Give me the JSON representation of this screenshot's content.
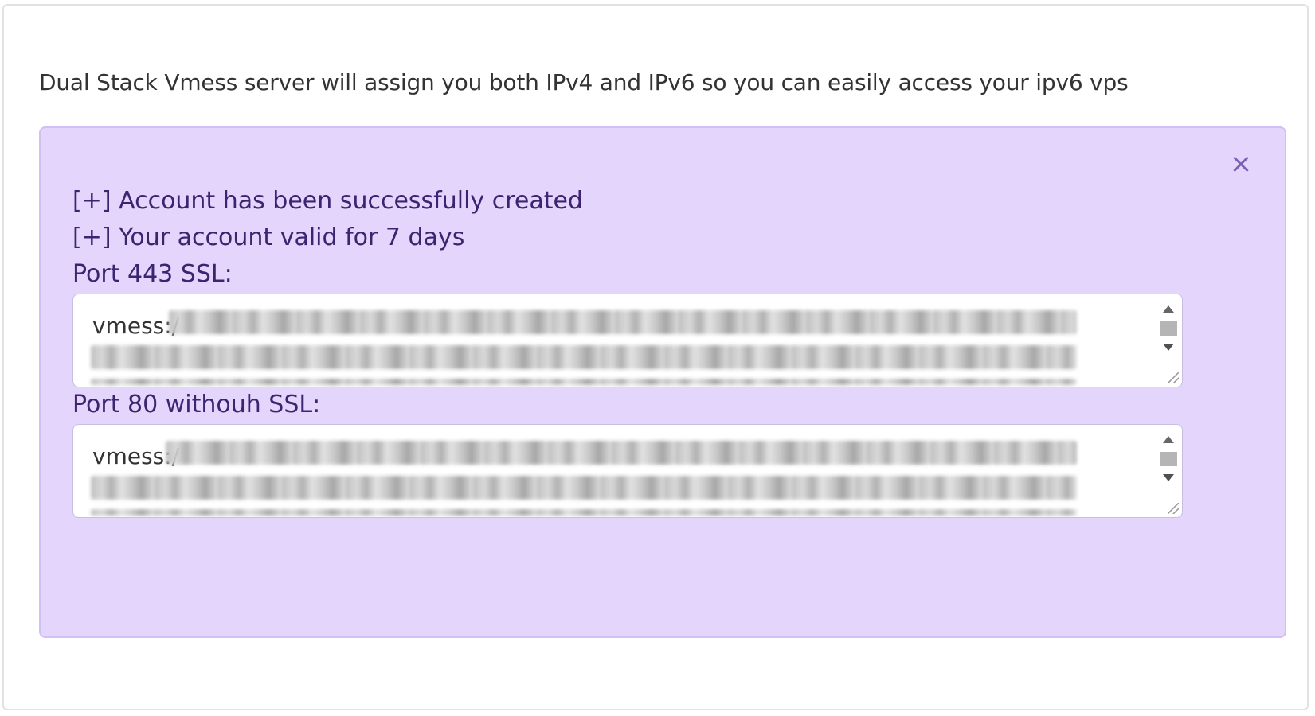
{
  "intro": {
    "text": "Dual Stack Vmess server will assign you both IPv4 and IPv6 so you can easily access your ipv6 vps"
  },
  "alert": {
    "close_symbol": "×",
    "lines": [
      "[+] Account has been successfully created",
      "[+] Your account valid for 7 days",
      "Port 443 SSL:",
      "Port 80 withouh SSL:"
    ],
    "ssl_link_visible_prefix": "vmess:/",
    "nonssl_link_visible_prefix": "vmess:/",
    "colors": {
      "alert_bg": "#e3d5fb",
      "alert_text": "#3d2470",
      "close_icon": "#7b5fb5"
    }
  }
}
